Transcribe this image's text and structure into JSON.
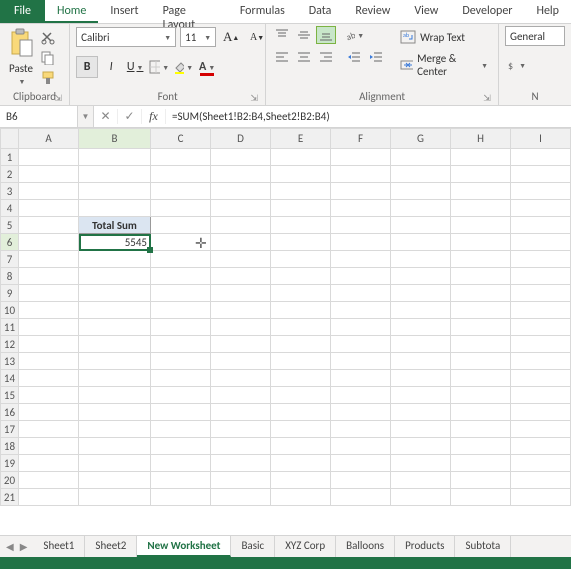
{
  "ribbon": {
    "file_tab": "File",
    "tabs": [
      "Home",
      "Insert",
      "Page Layout",
      "Formulas",
      "Data",
      "Review",
      "View",
      "Developer",
      "Help"
    ],
    "active_tab": "Home"
  },
  "clipboard": {
    "paste": "Paste",
    "label": "Clipboard"
  },
  "font": {
    "name": "Calibri",
    "size": "11",
    "bold": "B",
    "italic": "I",
    "underline": "U",
    "inc": "A",
    "dec": "A",
    "label": "Font"
  },
  "alignment": {
    "wrap": "Wrap Text",
    "merge": "Merge & Center",
    "label": "Alignment"
  },
  "number": {
    "format": "General",
    "label": "N"
  },
  "namebox": "B6",
  "formula": "=SUM(Sheet1!B2:B4,Sheet2!B2:B4)",
  "columns": [
    "A",
    "B",
    "C",
    "D",
    "E",
    "F",
    "G",
    "H",
    "I"
  ],
  "rows": [
    "1",
    "2",
    "3",
    "4",
    "5",
    "6",
    "7",
    "8",
    "9",
    "10",
    "11",
    "12",
    "13",
    "14",
    "15",
    "16",
    "17",
    "18",
    "19",
    "20",
    "21"
  ],
  "cells": {
    "b5": "Total Sum",
    "b6": "5545"
  },
  "sheets": [
    "Sheet1",
    "Sheet2",
    "New Worksheet",
    "Basic",
    "XYZ Corp",
    "Balloons",
    "Products",
    "Subtota"
  ],
  "active_sheet": "New Worksheet"
}
